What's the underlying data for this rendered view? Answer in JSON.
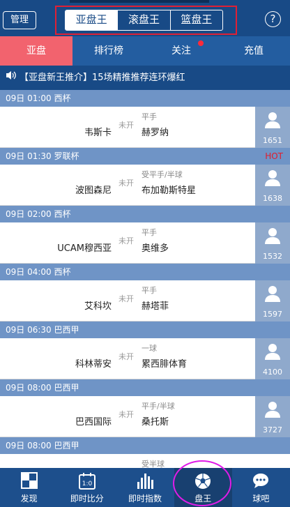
{
  "header": {
    "manage_label": "管理",
    "segments": [
      "亚盘王",
      "滚盘王",
      "篮盘王"
    ],
    "help_label": "?"
  },
  "tabs": [
    "亚盘",
    "排行榜",
    "关注",
    "充值"
  ],
  "marquee": "【亚盘新王推介】15场精推推荐连环爆红",
  "matches": [
    {
      "header": "09日 01:00 西杯",
      "hot": "",
      "home": "韦斯卡",
      "status": "未开",
      "handicap": "平手",
      "away": "赫罗纳",
      "count": "1651"
    },
    {
      "header": "09日 01:30 罗联杯",
      "hot": "HOT",
      "home": "波图森尼",
      "status": "未开",
      "handicap": "受平手/半球",
      "away": "布加勒斯特星",
      "count": "1638"
    },
    {
      "header": "09日 02:00 西杯",
      "hot": "",
      "home": "UCAM穆西亚",
      "status": "未开",
      "handicap": "平手",
      "away": "奥维多",
      "count": "1532"
    },
    {
      "header": "09日 04:00 西杯",
      "hot": "",
      "home": "艾科坎",
      "status": "未开",
      "handicap": "平手",
      "away": "赫塔菲",
      "count": "1597"
    },
    {
      "header": "09日 06:30 巴西甲",
      "hot": "",
      "home": "科林蒂安",
      "status": "未开",
      "handicap": "一球",
      "away": "累西腓体育",
      "count": "4100"
    },
    {
      "header": "09日 08:00 巴西甲",
      "hot": "",
      "home": "巴西国际",
      "status": "未开",
      "handicap": "平手/半球",
      "away": "桑托斯",
      "count": "3727"
    },
    {
      "header": "09日 08:00 巴西甲",
      "hot": "",
      "home": "",
      "status": "",
      "handicap": "受半球",
      "away": "",
      "count": ""
    }
  ],
  "bottom_nav": [
    "发现",
    "即时比分",
    "即时指数",
    "盘王",
    "球吧"
  ],
  "colors": {
    "header": "#184a86",
    "active_tab": "#f2636e",
    "match_header": "#6f94c6",
    "annotation": "#e01ce8"
  }
}
